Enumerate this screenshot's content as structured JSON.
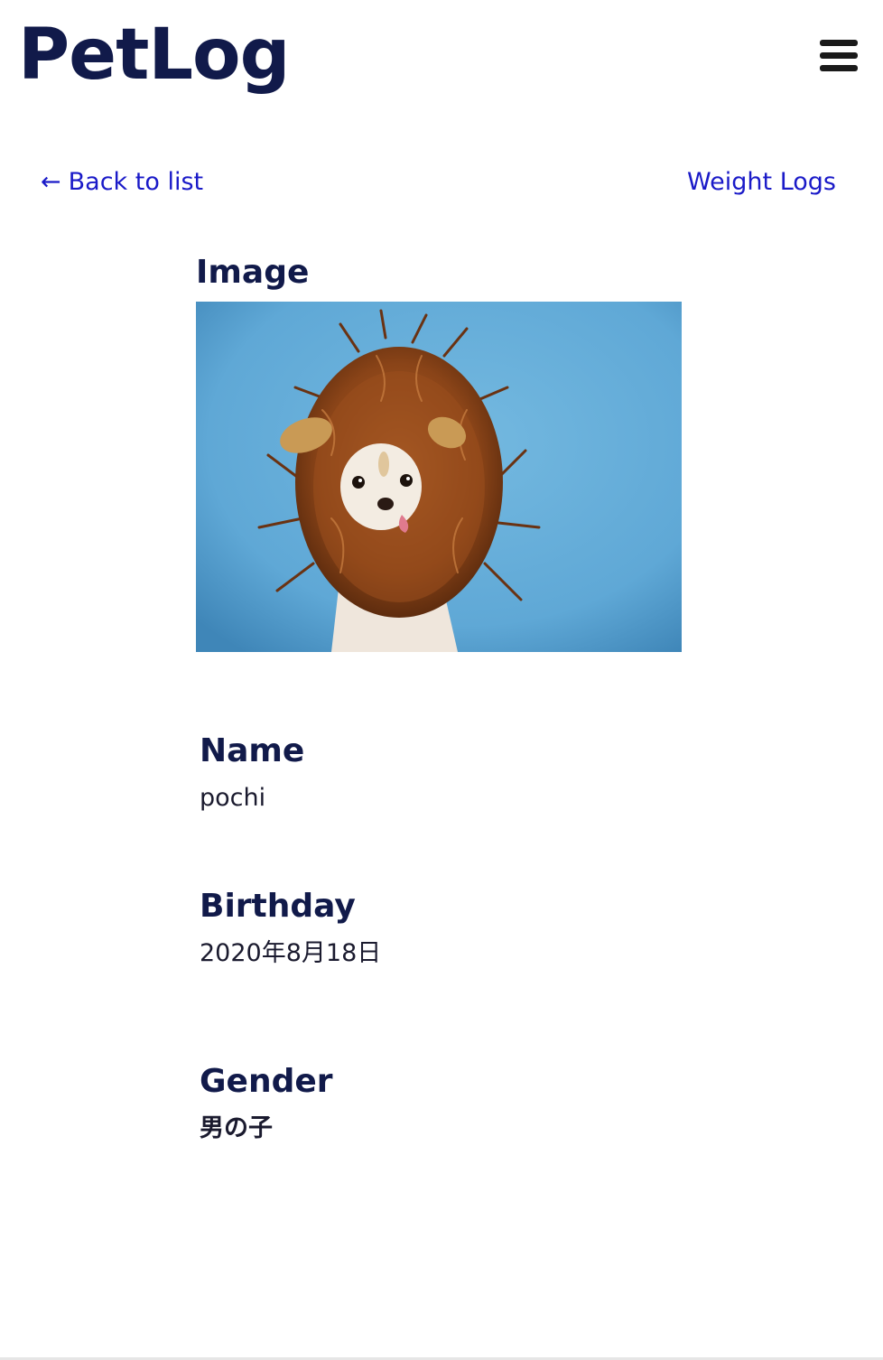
{
  "header": {
    "logo_text": "PetLog",
    "menu_icon": "hamburger-menu-icon"
  },
  "nav": {
    "back_arrow": "←",
    "back_label": "Back to list",
    "weight_logs_label": "Weight Logs"
  },
  "pet": {
    "image_heading": "Image",
    "name_heading": "Name",
    "name_value": "pochi",
    "birthday_heading": "Birthday",
    "birthday_value": "2020年8月18日",
    "gender_heading": "Gender",
    "gender_value": "男の子"
  },
  "colors": {
    "brand": "#111a4a",
    "link": "#1a1ac8",
    "photo_background": "#5fa8d6",
    "mane": "#8a4418"
  }
}
